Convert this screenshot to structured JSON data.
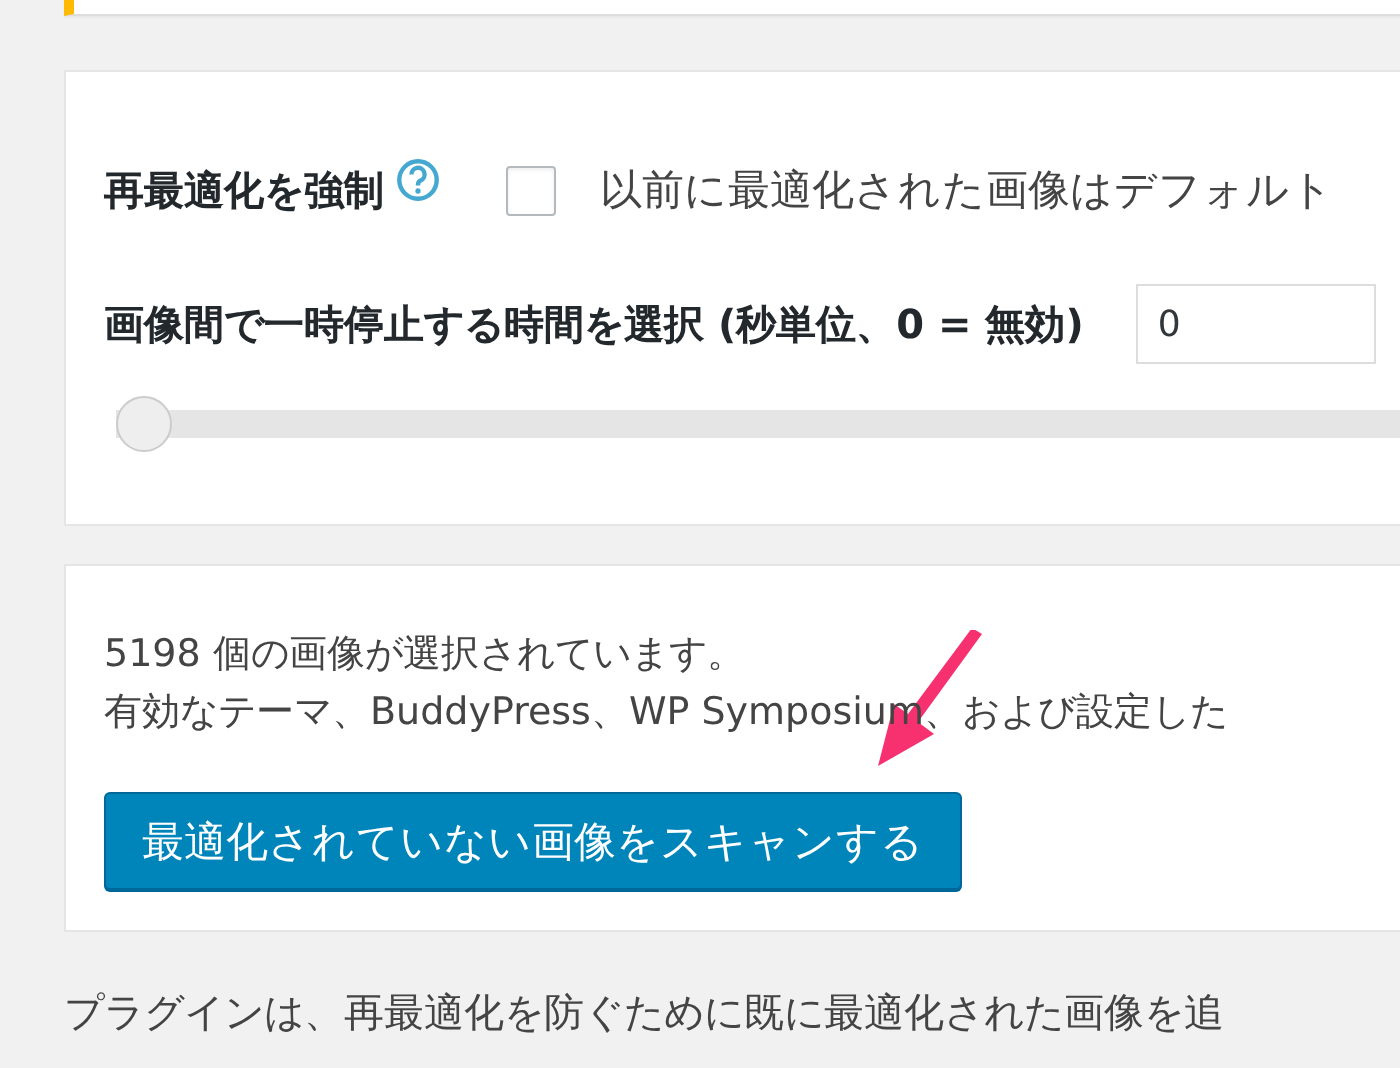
{
  "notice": {
    "kind": "warning"
  },
  "settings": {
    "force": {
      "label": "再最適化を強制",
      "checked": false,
      "description": "以前に最適化された画像はデフォルト"
    },
    "pause": {
      "label": "画像間で一時停止する時間を選択 (秒単位、0 = 無効)",
      "value": "0",
      "level": 0
    }
  },
  "scan": {
    "lines": [
      "5198 個の画像が選択されています。",
      "有効なテーマ、BuddyPress、WP Symposium、および設定した"
    ],
    "button": "最適化されていない画像をスキャンする"
  },
  "footer_text": "プラグインは、再最適化を防ぐために既に最適化された画像を追"
}
